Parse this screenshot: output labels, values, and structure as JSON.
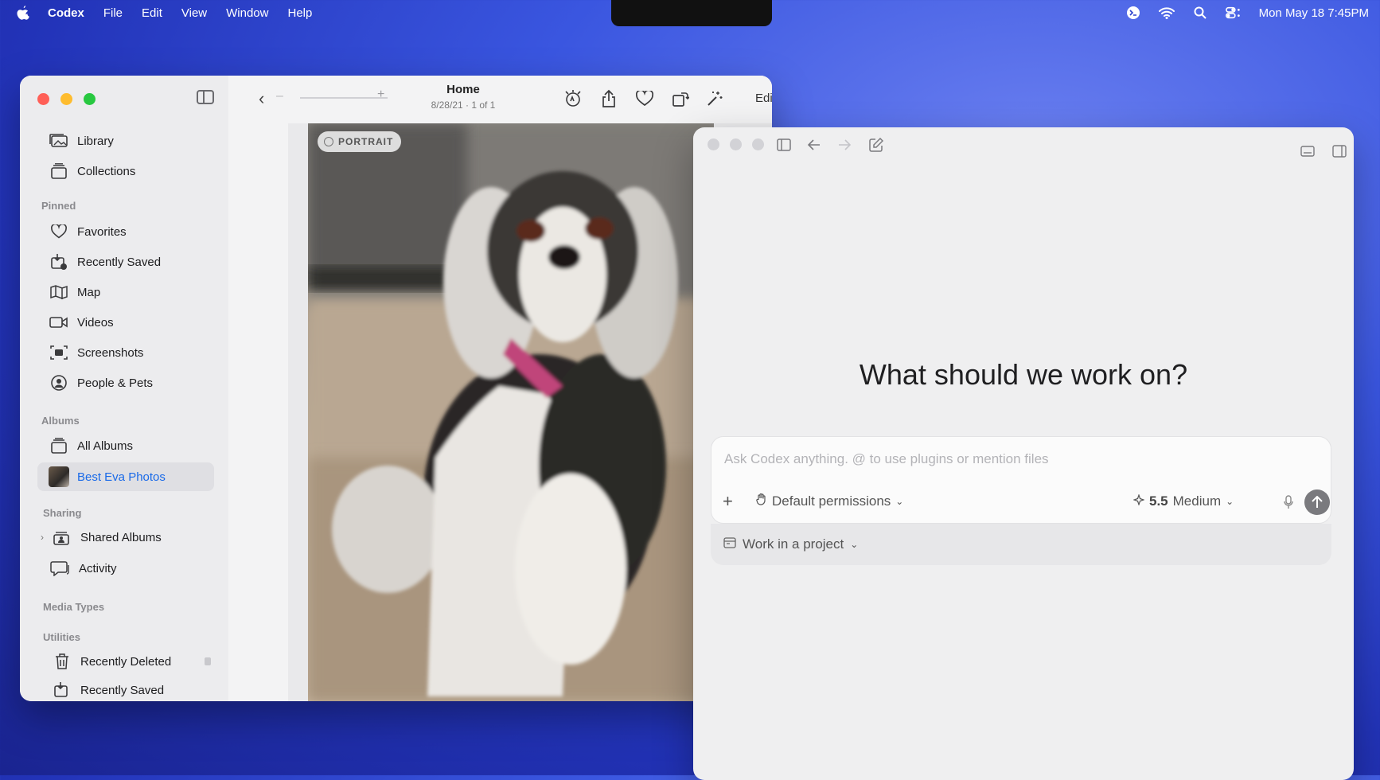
{
  "menubar": {
    "app_name": "Codex",
    "menus": [
      "File",
      "Edit",
      "View",
      "Window",
      "Help"
    ],
    "clock": "Mon May 18  7:45PM"
  },
  "photos": {
    "toolbar": {
      "title": "Home",
      "subtitle": "8/28/21 · 1 of 1",
      "edit_label": "Edit"
    },
    "sidebar": {
      "top_items": [
        {
          "label": "Library",
          "icon": "library-icon"
        },
        {
          "label": "Collections",
          "icon": "collections-icon"
        }
      ],
      "sections": {
        "pinned": "Pinned",
        "albums": "Albums",
        "sharing": "Sharing",
        "media_types": "Media Types",
        "utilities": "Utilities"
      },
      "pinned_items": [
        {
          "label": "Favorites",
          "icon": "heart-icon"
        },
        {
          "label": "Recently Saved",
          "icon": "recently-saved-icon"
        },
        {
          "label": "Map",
          "icon": "map-icon"
        },
        {
          "label": "Videos",
          "icon": "video-icon"
        },
        {
          "label": "Screenshots",
          "icon": "screenshot-icon"
        },
        {
          "label": "People & Pets",
          "icon": "person-icon"
        }
      ],
      "album_items": [
        {
          "label": "All Albums",
          "icon": "albums-icon"
        },
        {
          "label": "Best Eva Photos",
          "icon": "album-thumbnail",
          "selected": true
        }
      ],
      "sharing_items": [
        {
          "label": "Shared Albums",
          "icon": "shared-albums-icon"
        },
        {
          "label": "Activity",
          "icon": "activity-icon"
        }
      ],
      "utility_items": [
        {
          "label": "Recently Deleted",
          "icon": "trash-icon"
        },
        {
          "label": "Recently Saved",
          "icon": "recently-saved-icon"
        }
      ]
    },
    "photo": {
      "badge": "PORTRAIT"
    }
  },
  "codex": {
    "headline": "What should we work on?",
    "composer": {
      "placeholder": "Ask Codex anything. @ to use plugins or mention files",
      "permissions": "Default permissions",
      "model_version": "5.5",
      "model_effort": "Medium"
    },
    "project_selector": "Work in a project"
  },
  "colors": {
    "accent_blue": "#1a6ae8",
    "close_red": "#ff5f57",
    "minimize_yellow": "#febc2e",
    "zoom_green": "#28c840"
  }
}
